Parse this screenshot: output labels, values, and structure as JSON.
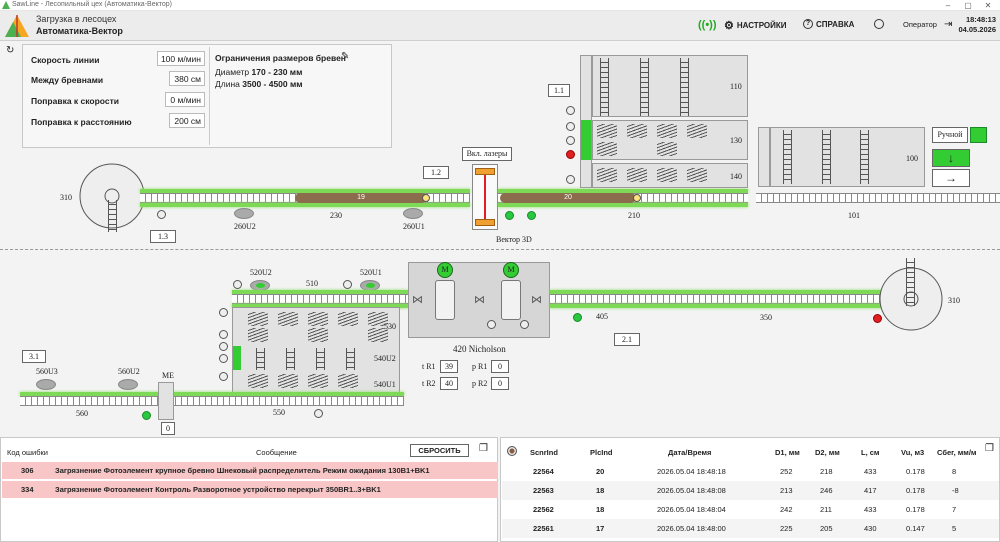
{
  "window": {
    "title": "SawLine - Лесопильный цех (Автоматика-Вектор)"
  },
  "header": {
    "line1": "Загрузка в лесоцех",
    "line2": "Автоматика-Вектор",
    "settings": "НАСТРОЙКИ",
    "help": "СПРАВКА",
    "user": "Оператор",
    "time": "18:48:13",
    "date": "04.05.2026"
  },
  "params": {
    "speed_label": "Скорость линии",
    "speed_value": "100 м/мин",
    "gap_label": "Между бревнами",
    "gap_value": "380 см",
    "speed_corr_label": "Поправка к скорости",
    "speed_corr_value": "0 м/мин",
    "dist_corr_label": "Поправка к расстоянию",
    "dist_corr_value": "200 см",
    "limits_title": "Ограничения размеров бревен",
    "diam_label": "Диаметр",
    "diam_value": "170 - 230 мм",
    "len_label": "Длина",
    "len_value": "3500 - 4500 мм"
  },
  "scheme": {
    "l310a": "310",
    "l230": "230",
    "l260u2": "260U2",
    "l260u1": "260U1",
    "l210": "210",
    "l101": "101",
    "b13": "1.3",
    "b12": "1.2",
    "b11": "1.1",
    "laser": "Вкл. лазеры",
    "vector": "Вектор 3D",
    "log19": "19",
    "log20": "20",
    "l110": "110",
    "l130": "130",
    "l140": "140",
    "l100": "100",
    "manual": "Ручной",
    "arrow_down": "↓",
    "arrow_right": "→",
    "l520u2": "520U2",
    "l520u1": "520U1",
    "l510": "510",
    "l530": "530",
    "l540u2": "540U2",
    "l540u1": "540U1",
    "nich": "420 Nicholson",
    "m": "M",
    "tr1": "t R1",
    "tr1v": "39",
    "pr1": "p R1",
    "pr1v": "0",
    "tr2": "t R2",
    "tr2v": "40",
    "pr2": "p R2",
    "pr2v": "0",
    "l405": "405",
    "l350": "350",
    "l310b": "310",
    "b21": "2.1",
    "b31": "3.1",
    "l560u3": "560U3",
    "l560u2": "560U2",
    "me": "ME",
    "me_v": "0",
    "l560": "560",
    "l550": "550"
  },
  "errors": {
    "col_code": "Код ошибки",
    "col_msg": "Сообщение",
    "reset": "СБРОСИТЬ",
    "rows": [
      {
        "code": "306",
        "msg": "Загрязнение Фотоэлемент крупное бревно Шнековый распределитель Режим ожидания 130B1+BK1"
      },
      {
        "code": "334",
        "msg": "Загрязнение Фотоэлемент Контроль Разворотное устройство перекрыт 350BR1..3+BK1"
      }
    ]
  },
  "logs": {
    "cols": [
      "ScnrInd",
      "PlcInd",
      "Дата/Время",
      "D1, мм",
      "D2, мм",
      "L, см",
      "Vu, м3",
      "Сбег, мм/м"
    ],
    "rows": [
      [
        "22564",
        "20",
        "2026.05.04 18:48:18",
        "252",
        "218",
        "433",
        "0.178",
        "8"
      ],
      [
        "22563",
        "18",
        "2026.05.04 18:48:08",
        "213",
        "246",
        "417",
        "0.178",
        "-8"
      ],
      [
        "22562",
        "18",
        "2026.05.04 18:48:04",
        "242",
        "211",
        "433",
        "0.178",
        "7"
      ],
      [
        "22561",
        "17",
        "2026.05.04 18:48:00",
        "225",
        "205",
        "430",
        "0.147",
        "5"
      ]
    ]
  }
}
